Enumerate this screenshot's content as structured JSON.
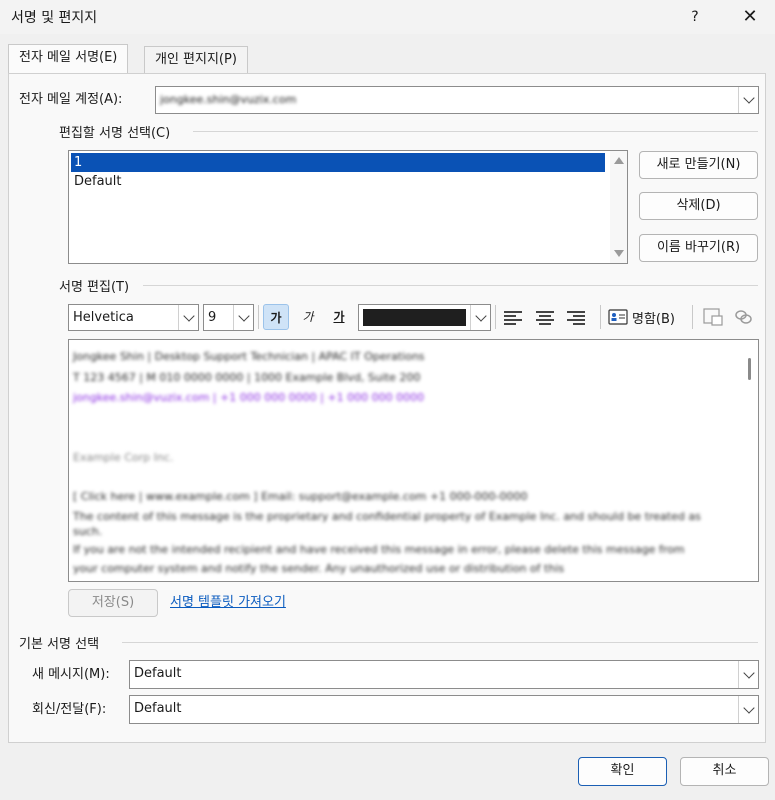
{
  "window": {
    "title": "서명 및 편지지",
    "help": "?",
    "close": "✕"
  },
  "tabs": [
    {
      "label": "전자 메일 서명(E)"
    },
    {
      "label": "개인 편지지(P)"
    }
  ],
  "account": {
    "label": "전자 메일 계정(A):",
    "value": "jongkee.shin@vuzix.com"
  },
  "select_signature": {
    "label": "편집할 서명 선택(C)",
    "items": [
      {
        "label": "1"
      },
      {
        "label": "Default"
      }
    ],
    "new_button": "새로 만들기(N)",
    "delete_button": "삭제(D)",
    "rename_button": "이름 바꾸기(R)"
  },
  "edit_signature": {
    "label": "서명 편집(T)",
    "font": "Helvetica",
    "size": "9",
    "bold": "가",
    "italic": "가",
    "underline": "가",
    "font_color": "#1f1f1f",
    "business_card": "명함(B)",
    "lines": [
      "Jongkee Shin | Desktop Support Technician | APAC IT Operations",
      "T 123 4567 | M 010 0000 0000 | 1000 Example Blvd, Suite 200",
      "jongkee.shin@vuzix.com    |  +1 000 000 0000  |  +1 000 000 0000",
      "",
      "Example Corp Inc.",
      "",
      "[ Click here | www.example.com ]  Email: support@example.com  +1 000-000-0000",
      "The content of this message is the proprietary and confidential property of Example Inc. and should be treated as",
      "such.",
      "If you are not the intended recipient and have received this message in error, please delete this message from",
      "your computer system and notify the sender. Any unauthorized use or distribution of this"
    ],
    "save_button": "저장(S)",
    "template_link": "서명 템플릿 가져오기"
  },
  "default_signature": {
    "label": "기본 서명 선택",
    "new_messages_label": "새 메시지(M):",
    "new_messages_value": "Default",
    "replies_label": "회신/전달(F):",
    "replies_value": "Default"
  },
  "footer": {
    "ok": "확인",
    "cancel": "취소"
  },
  "colors": {
    "selection": "#0a52b5",
    "link": "#0a5bbf",
    "primary_border": "#1b5fb4"
  }
}
